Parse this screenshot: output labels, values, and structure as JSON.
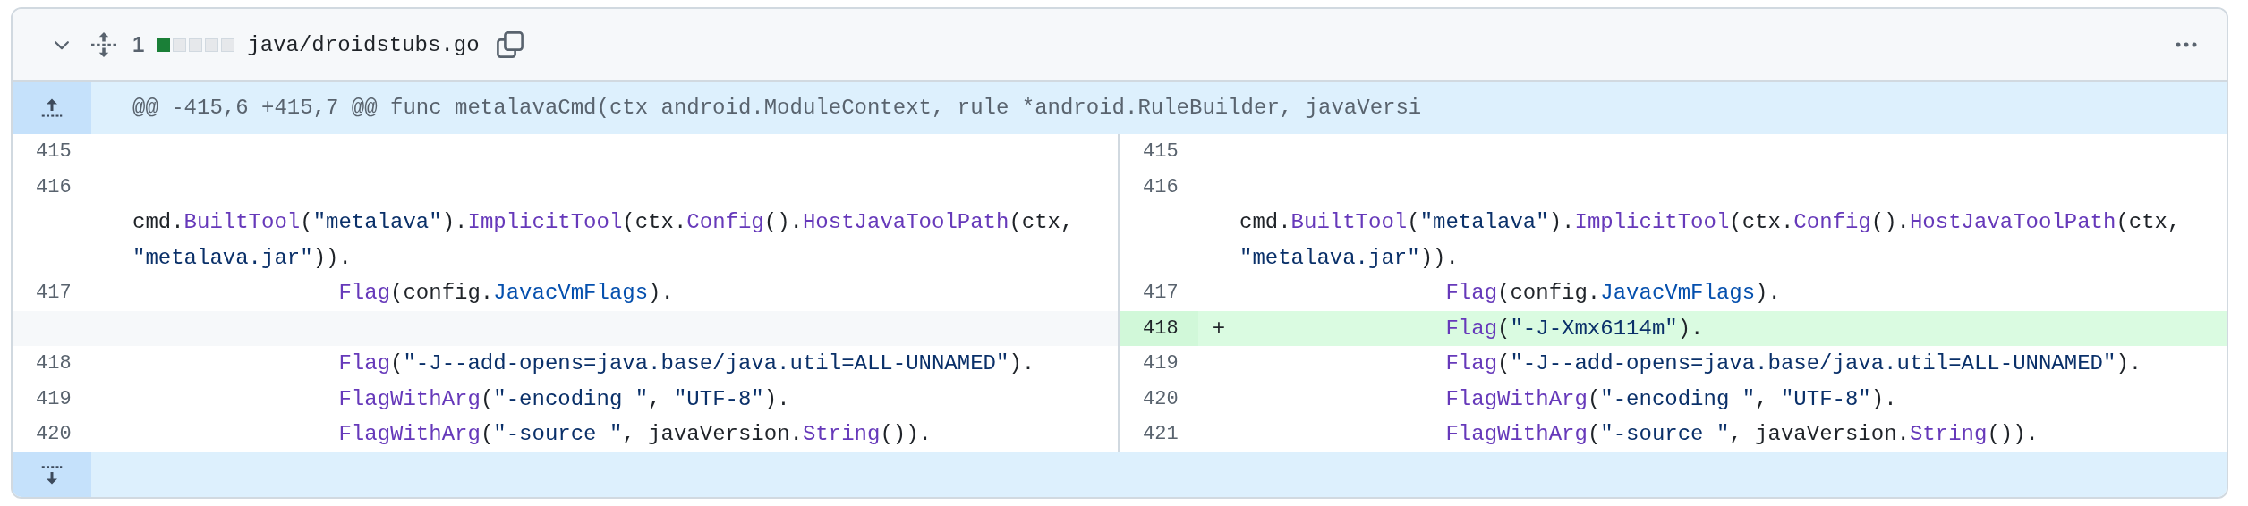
{
  "file_header": {
    "expanded": true,
    "change_count": "1",
    "diffstat": [
      {
        "kind": "added"
      },
      {
        "kind": "neutral"
      },
      {
        "kind": "neutral"
      },
      {
        "kind": "neutral"
      },
      {
        "kind": "neutral"
      }
    ],
    "path": "java/droidstubs.go"
  },
  "hunk_header": "@@ -415,6 +415,7 @@ func metalavaCmd(ctx android.ModuleContext, rule *android.RuleBuilder, javaVersi",
  "rows": [
    {
      "left": {
        "number": "415",
        "kind": "context"
      },
      "right": {
        "number": "415",
        "kind": "context"
      }
    },
    {
      "left": {
        "number": "416",
        "kind": "context",
        "code": [
          {
            "text": "\tcmd.",
            "kind": "plain"
          },
          {
            "text": "BuiltTool",
            "kind": "func"
          },
          {
            "text": "(",
            "kind": "plain"
          },
          {
            "text": "\"metalava\"",
            "kind": "string"
          },
          {
            "text": ").",
            "kind": "plain"
          },
          {
            "text": "ImplicitTool",
            "kind": "func"
          },
          {
            "text": "(ctx.",
            "kind": "plain"
          },
          {
            "text": "Config",
            "kind": "func"
          },
          {
            "text": "().",
            "kind": "plain"
          },
          {
            "text": "HostJavaToolPath",
            "kind": "func"
          },
          {
            "text": "(ctx, ",
            "kind": "plain"
          },
          {
            "text": "\"metalava.jar\"",
            "kind": "string"
          },
          {
            "text": ")).",
            "kind": "plain"
          }
        ]
      },
      "right": {
        "number": "416",
        "kind": "context",
        "code": [
          {
            "text": "\tcmd.",
            "kind": "plain"
          },
          {
            "text": "BuiltTool",
            "kind": "func"
          },
          {
            "text": "(",
            "kind": "plain"
          },
          {
            "text": "\"metalava\"",
            "kind": "string"
          },
          {
            "text": ").",
            "kind": "plain"
          },
          {
            "text": "ImplicitTool",
            "kind": "func"
          },
          {
            "text": "(ctx.",
            "kind": "plain"
          },
          {
            "text": "Config",
            "kind": "func"
          },
          {
            "text": "().",
            "kind": "plain"
          },
          {
            "text": "HostJavaToolPath",
            "kind": "func"
          },
          {
            "text": "(ctx, ",
            "kind": "plain"
          },
          {
            "text": "\"metalava.jar\"",
            "kind": "string"
          },
          {
            "text": ")).",
            "kind": "plain"
          }
        ]
      }
    },
    {
      "left": {
        "number": "417",
        "kind": "context",
        "code": [
          {
            "text": "\t\tFlag",
            "kind": "func"
          },
          {
            "text": "(config.",
            "kind": "plain"
          },
          {
            "text": "JavacVmFlags",
            "kind": "field"
          },
          {
            "text": ").",
            "kind": "plain"
          }
        ]
      },
      "right": {
        "number": "417",
        "kind": "context",
        "code": [
          {
            "text": "\t\tFlag",
            "kind": "func"
          },
          {
            "text": "(config.",
            "kind": "plain"
          },
          {
            "text": "JavacVmFlags",
            "kind": "field"
          },
          {
            "text": ").",
            "kind": "plain"
          }
        ]
      }
    },
    {
      "left": null,
      "right": {
        "number": "418",
        "kind": "addition",
        "marker": "+",
        "code": [
          {
            "text": "\t\tFlag",
            "kind": "func"
          },
          {
            "text": "(",
            "kind": "plain"
          },
          {
            "text": "\"-J-Xmx6114m\"",
            "kind": "string"
          },
          {
            "text": ").",
            "kind": "plain"
          }
        ]
      }
    },
    {
      "left": {
        "number": "418",
        "kind": "context",
        "code": [
          {
            "text": "\t\tFlag",
            "kind": "func"
          },
          {
            "text": "(",
            "kind": "plain"
          },
          {
            "text": "\"-J--add-opens=java.base/java.util=ALL-UNNAMED\"",
            "kind": "string"
          },
          {
            "text": ").",
            "kind": "plain"
          }
        ]
      },
      "right": {
        "number": "419",
        "kind": "context",
        "code": [
          {
            "text": "\t\tFlag",
            "kind": "func"
          },
          {
            "text": "(",
            "kind": "plain"
          },
          {
            "text": "\"-J--add-opens=java.base/java.util=ALL-UNNAMED\"",
            "kind": "string"
          },
          {
            "text": ").",
            "kind": "plain"
          }
        ]
      }
    },
    {
      "left": {
        "number": "419",
        "kind": "context",
        "code": [
          {
            "text": "\t\tFlagWithArg",
            "kind": "func"
          },
          {
            "text": "(",
            "kind": "plain"
          },
          {
            "text": "\"-encoding \"",
            "kind": "string"
          },
          {
            "text": ", ",
            "kind": "plain"
          },
          {
            "text": "\"UTF-8\"",
            "kind": "string"
          },
          {
            "text": ").",
            "kind": "plain"
          }
        ]
      },
      "right": {
        "number": "420",
        "kind": "context",
        "code": [
          {
            "text": "\t\tFlagWithArg",
            "kind": "func"
          },
          {
            "text": "(",
            "kind": "plain"
          },
          {
            "text": "\"-encoding \"",
            "kind": "string"
          },
          {
            "text": ", ",
            "kind": "plain"
          },
          {
            "text": "\"UTF-8\"",
            "kind": "string"
          },
          {
            "text": ").",
            "kind": "plain"
          }
        ]
      }
    },
    {
      "left": {
        "number": "420",
        "kind": "context",
        "code": [
          {
            "text": "\t\tFlagWithArg",
            "kind": "func"
          },
          {
            "text": "(",
            "kind": "plain"
          },
          {
            "text": "\"-source \"",
            "kind": "string"
          },
          {
            "text": ", javaVersion.",
            "kind": "plain"
          },
          {
            "text": "String",
            "kind": "func"
          },
          {
            "text": "()).",
            "kind": "plain"
          }
        ]
      },
      "right": {
        "number": "421",
        "kind": "context",
        "code": [
          {
            "text": "\t\tFlagWithArg",
            "kind": "func"
          },
          {
            "text": "(",
            "kind": "plain"
          },
          {
            "text": "\"-source \"",
            "kind": "string"
          },
          {
            "text": ", javaVersion.",
            "kind": "plain"
          },
          {
            "text": "String",
            "kind": "func"
          },
          {
            "text": "()).",
            "kind": "plain"
          }
        ]
      }
    }
  ]
}
